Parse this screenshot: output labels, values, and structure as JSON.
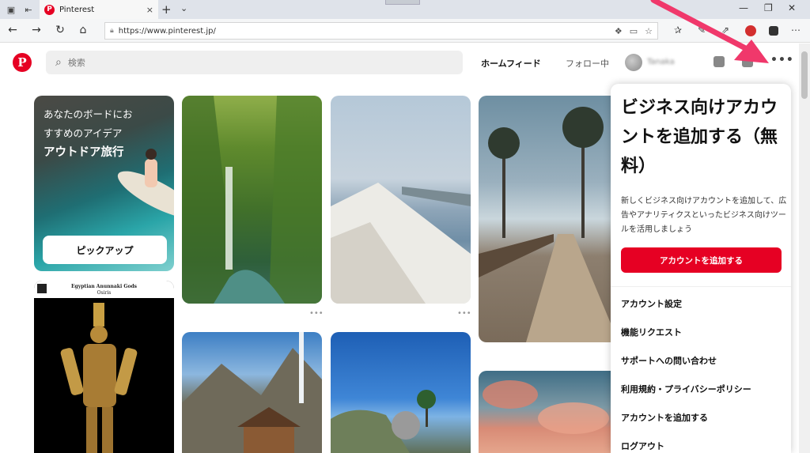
{
  "browser": {
    "tab_title": "Pinterest",
    "tab_favicon": "P",
    "tab_close_icon": "×",
    "new_tab_icon": "+",
    "tab_menu_icon": "⌄",
    "url": "https://www.pinterest.jp/"
  },
  "header": {
    "logo": "P",
    "search_placeholder": "検索",
    "home_feed": "ホームフィード",
    "following": "フォロー中",
    "username": "Tanaka",
    "more_icon": "•••"
  },
  "feed": {
    "ad_pin": {
      "line1": "あなたのボードにお",
      "line2": "すすめのアイデア",
      "line3": "アウトドア旅行",
      "button": "ピックアップ"
    },
    "osiris_pin": {
      "title": "Egyptian Anunnaki Gods",
      "subtitle": "Osiris"
    },
    "pin_more_icon": "•••"
  },
  "dropdown": {
    "heading": "ビジネス向けアカウントを追加する（無料）",
    "description": "新しくビジネス向けアカウントを追加して、広告やアナリティクスといったビジネス向けツールを活用しましょう",
    "cta": "アカウントを追加する",
    "items": [
      "アカウント設定",
      "機能リクエスト",
      "サポートへの問い合わせ",
      "利用規約・プライバシーポリシー",
      "アカウントを追加する",
      "ログアウト"
    ]
  },
  "colors": {
    "pinterest_red": "#e60023",
    "arrow": "#f0386b"
  }
}
